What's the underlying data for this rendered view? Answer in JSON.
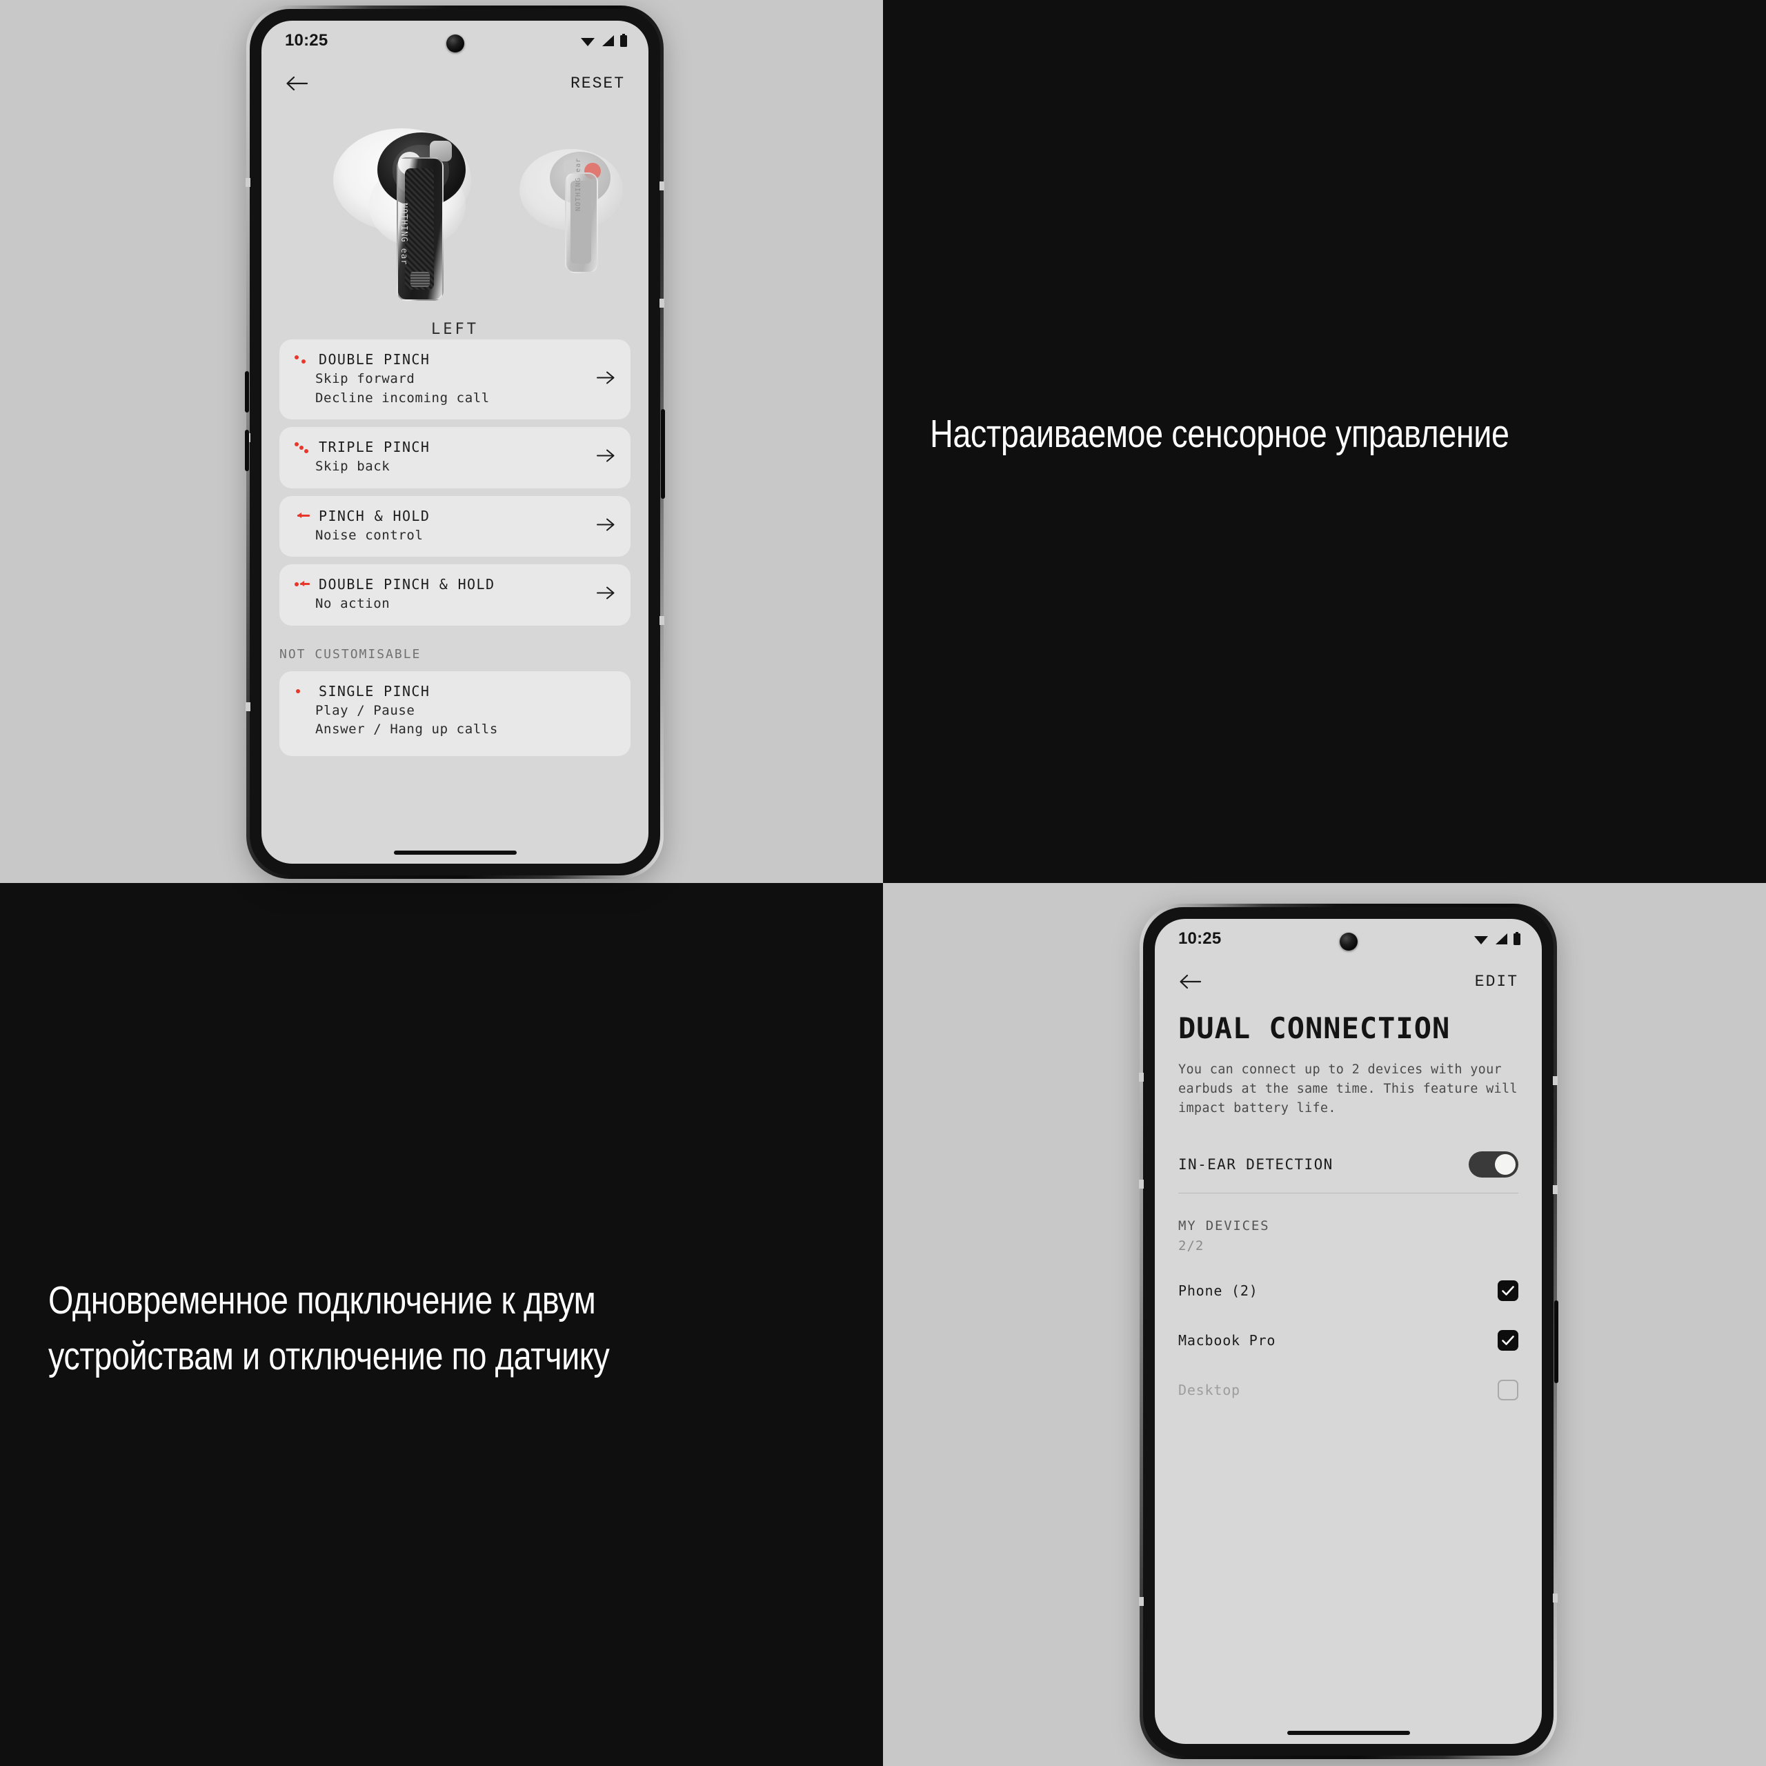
{
  "background": {
    "light": "#c8c8c8",
    "dark": "#0f0f0f",
    "screen": "#d7d7d7",
    "card": "#e8e8e8",
    "accent": "#e8372a"
  },
  "captions": {
    "touch_controls": "Настраиваемое сенсорное управление",
    "dual_connection": "Одновременное подключение к двум\nустройствам и отключение по датчику"
  },
  "phone_gestures": {
    "status": {
      "time": "10:25",
      "icons": [
        "wifi-icon",
        "signal-icon",
        "battery-icon"
      ]
    },
    "appbar": {
      "back": "back-arrow-icon",
      "action": "RESET"
    },
    "hero": {
      "label": "LEFT",
      "left_bud": "nothing-ear-left",
      "right_bud": "nothing-ear-right"
    },
    "cards": [
      {
        "icon": "double-pinch-icon",
        "title": "DOUBLE PINCH",
        "lines": [
          "Skip forward",
          "Decline incoming call"
        ],
        "chevron": "arrow-right-icon"
      },
      {
        "icon": "triple-pinch-icon",
        "title": "TRIPLE PINCH",
        "lines": [
          "Skip back"
        ],
        "chevron": "arrow-right-icon"
      },
      {
        "icon": "pinch-hold-icon",
        "title": "PINCH & HOLD",
        "lines": [
          "Noise control"
        ],
        "chevron": "arrow-right-icon"
      },
      {
        "icon": "double-pinch-hold-icon",
        "title": "DOUBLE PINCH & HOLD",
        "lines": [
          "No action"
        ],
        "chevron": "arrow-right-icon"
      }
    ],
    "section_label": "NOT CUSTOMISABLE",
    "fixed_card": {
      "icon": "single-pinch-icon",
      "title": "SINGLE PINCH",
      "lines": [
        "Play / Pause",
        "Answer / Hang up calls"
      ]
    }
  },
  "phone_dual": {
    "status": {
      "time": "10:25",
      "icons": [
        "wifi-icon",
        "signal-icon",
        "battery-icon"
      ]
    },
    "appbar": {
      "back": "back-arrow-icon",
      "action": "EDIT"
    },
    "title": "DUAL CONNECTION",
    "description": "You can connect up to 2 devices with your earbuds at the same time. This feature will impact battery life.",
    "in_ear": {
      "label": "IN-EAR DETECTION",
      "state": "on"
    },
    "devices_header": {
      "label": "MY DEVICES",
      "count": "2/2"
    },
    "devices": [
      {
        "name": "Phone (2)",
        "checked": true,
        "disabled": false
      },
      {
        "name": "Macbook Pro",
        "checked": true,
        "disabled": false
      },
      {
        "name": "Desktop",
        "checked": false,
        "disabled": true
      }
    ]
  }
}
